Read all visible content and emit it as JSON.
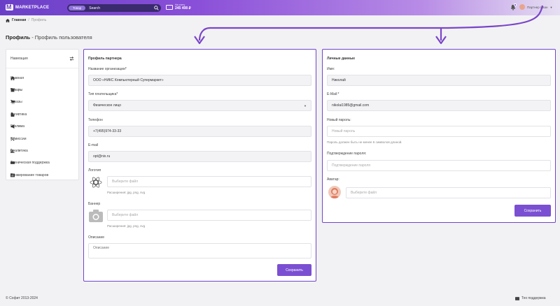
{
  "header": {
    "logo_text": "MARKETPLACE",
    "search_pill": "Товар",
    "search_value": "Search",
    "wallet_label": "На счету",
    "wallet_value": "245 408 ₽",
    "user_name": "Партнер Иван",
    "accent_color": "#6a3fc7"
  },
  "breadcrumbs": {
    "home": "Главная",
    "separator": "/",
    "current": "Профиль"
  },
  "page_title": {
    "bold": "Профиль",
    "rest": " - Профиль пользователя"
  },
  "sidebar": {
    "title": "Навигация",
    "items": [
      {
        "label": "Главная",
        "icon": "home-icon",
        "has_chevron": false
      },
      {
        "label": "Товары",
        "icon": "box-icon",
        "has_chevron": true
      },
      {
        "label": "Заказы",
        "icon": "cart-icon",
        "has_chevron": false
      },
      {
        "label": "Логистика",
        "icon": "building-icon",
        "has_chevron": true
      },
      {
        "label": "Реклама",
        "icon": "megaphone-icon",
        "has_chevron": true
      },
      {
        "label": "Комиссии",
        "icon": "percent-icon",
        "has_chevron": false
      },
      {
        "label": "Аналитика",
        "icon": "chart-icon",
        "has_chevron": true
      },
      {
        "label": "Техническая поддержка",
        "icon": "support-icon",
        "has_chevron": false
      },
      {
        "label": "Ранжирование товаров",
        "icon": "ranking-icon",
        "has_chevron": false
      }
    ]
  },
  "partner": {
    "title": "Профиль партнера",
    "org_label": "Название организации*",
    "org_value": "ООО «НИКС Компьютерный Супермаркет»",
    "payer_label": "Тип плательщика*",
    "payer_value": "Физическое лицо",
    "phone_label": "Телефон",
    "phone_value": "+7(495)974-33-33",
    "email_label": "E-mail",
    "email_value": "opt@nix.ru",
    "logo_label": "Логотип",
    "logo_placeholder": "Выберите файл",
    "logo_hint": "Расширения: jpg, png, svg",
    "banner_label": "Баннер",
    "banner_placeholder": "Выберите файл",
    "banner_hint": "Расширения: jpg, png, svg",
    "desc_label": "Описание",
    "desc_placeholder": "Описание",
    "save_label": "Сохранить"
  },
  "personal": {
    "title": "Личные данные",
    "name_label": "Имя:",
    "name_value": "Николай",
    "email_label": "E-Mail:*",
    "email_value": "nikolai1985@gmail.com",
    "password_label": "Новый пароль:",
    "password_placeholder": "Новый пароль",
    "password_hint": "Пароль должен быть не менее 6 символов длиной.",
    "confirm_label": "Подтверждение пароля:",
    "confirm_placeholder": "Подтверждение пароля",
    "avatar_label": "Аватар:",
    "avatar_placeholder": "Выберите файл",
    "save_label": "Сохранить"
  },
  "footer": {
    "copyright": "© Софит 2013-2024",
    "support": "Тех поддержка"
  }
}
